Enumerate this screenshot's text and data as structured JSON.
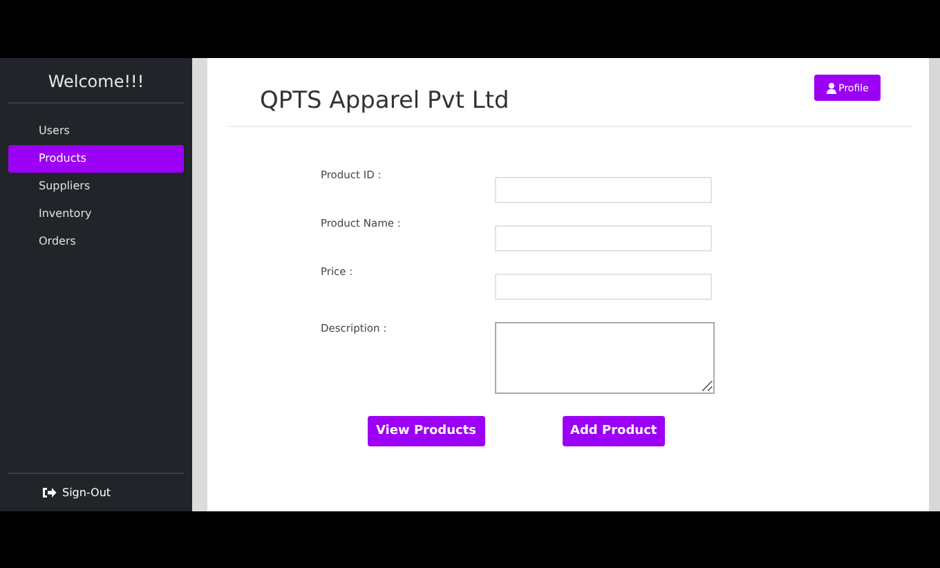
{
  "sidebar": {
    "title": "Welcome!!!",
    "items": [
      {
        "label": "Users",
        "selected": false
      },
      {
        "label": "Products",
        "selected": true
      },
      {
        "label": "Suppliers",
        "selected": false
      },
      {
        "label": "Inventory",
        "selected": false
      },
      {
        "label": "Orders",
        "selected": false
      }
    ],
    "sign_out": "Sign-Out"
  },
  "header": {
    "title": "QPTS Apparel Pvt Ltd",
    "profile_button": "Profile"
  },
  "form": {
    "fields": [
      {
        "label": "Product ID :",
        "kind": "input"
      },
      {
        "label": "Product Name :",
        "kind": "input"
      },
      {
        "label": "Price :",
        "kind": "input"
      },
      {
        "label": "Description :",
        "kind": "textarea"
      }
    ],
    "buttons": [
      "View Products",
      "Add Product"
    ]
  }
}
